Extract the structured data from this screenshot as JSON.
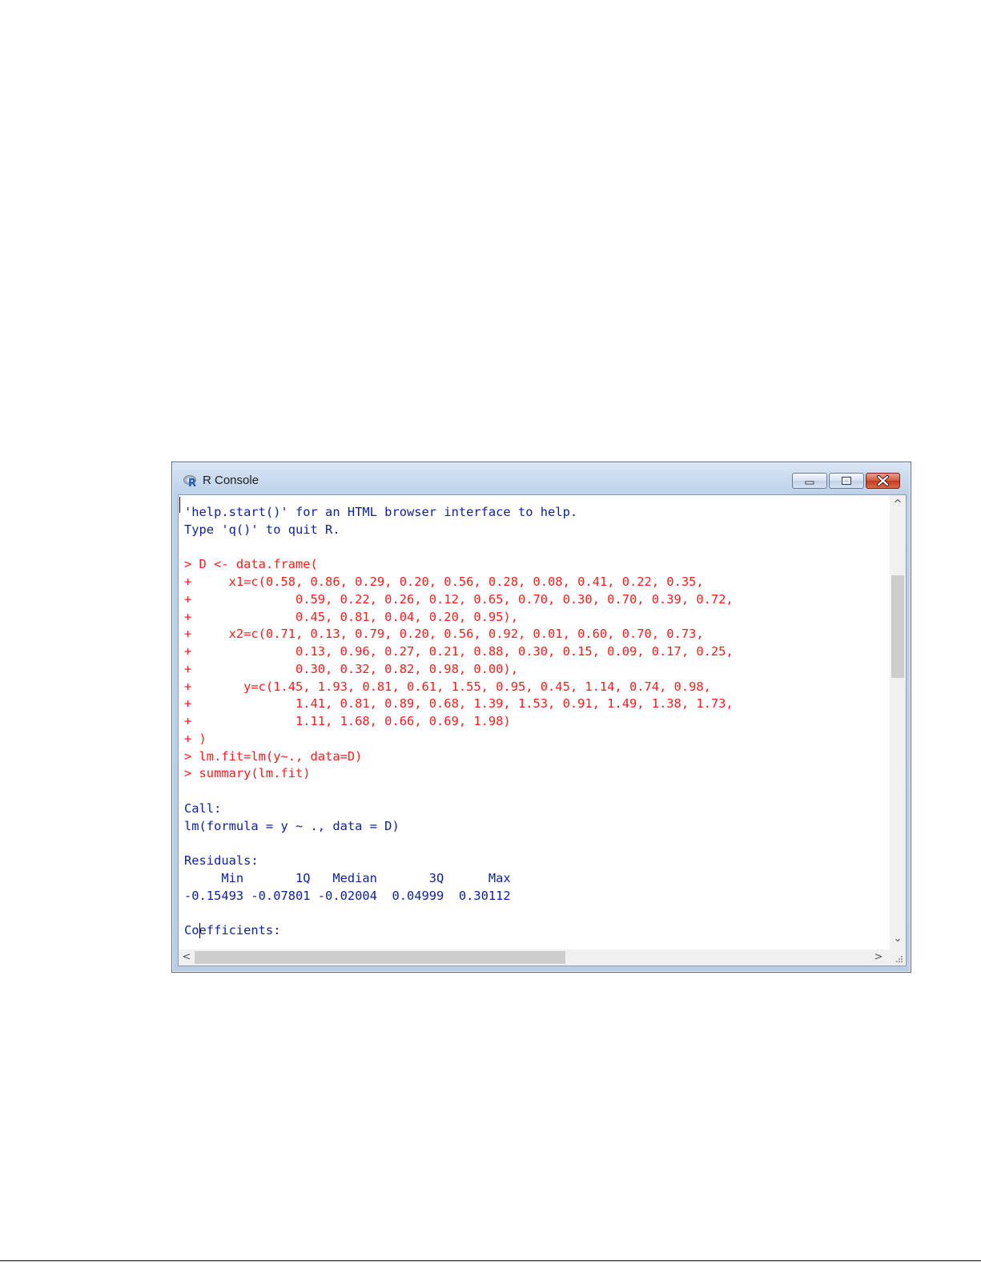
{
  "window": {
    "title": "R Console"
  },
  "console": {
    "lines": [
      {
        "text": "'help.start()' for an HTML browser interface to help.",
        "kind": "output"
      },
      {
        "text": "Type 'q()' to quit R.",
        "kind": "output"
      },
      {
        "text": "",
        "kind": "output"
      },
      {
        "text": "> D <- data.frame(",
        "kind": "input"
      },
      {
        "text": "+     x1=c(0.58, 0.86, 0.29, 0.20, 0.56, 0.28, 0.08, 0.41, 0.22, 0.35,",
        "kind": "input"
      },
      {
        "text": "+              0.59, 0.22, 0.26, 0.12, 0.65, 0.70, 0.30, 0.70, 0.39, 0.72,",
        "kind": "input"
      },
      {
        "text": "+              0.45, 0.81, 0.04, 0.20, 0.95),",
        "kind": "input"
      },
      {
        "text": "+     x2=c(0.71, 0.13, 0.79, 0.20, 0.56, 0.92, 0.01, 0.60, 0.70, 0.73,",
        "kind": "input"
      },
      {
        "text": "+              0.13, 0.96, 0.27, 0.21, 0.88, 0.30, 0.15, 0.09, 0.17, 0.25,",
        "kind": "input"
      },
      {
        "text": "+              0.30, 0.32, 0.82, 0.98, 0.00),",
        "kind": "input"
      },
      {
        "text": "+       y=c(1.45, 1.93, 0.81, 0.61, 1.55, 0.95, 0.45, 1.14, 0.74, 0.98,",
        "kind": "input"
      },
      {
        "text": "+              1.41, 0.81, 0.89, 0.68, 1.39, 1.53, 0.91, 1.49, 1.38, 1.73,",
        "kind": "input"
      },
      {
        "text": "+              1.11, 1.68, 0.66, 0.69, 1.98)",
        "kind": "input"
      },
      {
        "text": "+ )",
        "kind": "input"
      },
      {
        "text": "> lm.fit=lm(y~., data=D)",
        "kind": "input"
      },
      {
        "text": "> summary(lm.fit)",
        "kind": "input"
      },
      {
        "text": "",
        "kind": "output"
      },
      {
        "text": "Call:",
        "kind": "output"
      },
      {
        "text": "lm(formula = y ~ ., data = D)",
        "kind": "output"
      },
      {
        "text": "",
        "kind": "output"
      },
      {
        "text": "Residuals:",
        "kind": "output"
      },
      {
        "text": "     Min       1Q   Median       3Q      Max ",
        "kind": "output"
      },
      {
        "text": "-0.15493 -0.07801 -0.02004  0.04999  0.30112 ",
        "kind": "output"
      },
      {
        "text": "",
        "kind": "output"
      },
      {
        "text": "Coefficients:",
        "kind": "output"
      }
    ]
  },
  "colors": {
    "input_text": "#ff1a1a",
    "output_text": "#0b1fa0"
  },
  "icons": {
    "app": "r-logo-icon",
    "minimize": "minimize-icon",
    "maximize": "maximize-icon",
    "close": "close-icon",
    "scroll_up": "scroll-up-arrow-icon",
    "scroll_down": "scroll-down-arrow-icon",
    "scroll_left": "scroll-left-arrow-icon",
    "scroll_right": "scroll-right-arrow-icon",
    "resize": "resize-grip-icon"
  },
  "scroll_arrows": {
    "up": "^",
    "down": "⌄",
    "left": "<",
    "right": ">"
  }
}
